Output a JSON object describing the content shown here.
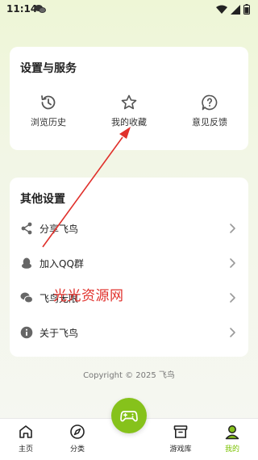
{
  "status_bar": {
    "time": "11:14"
  },
  "services": {
    "title": "设置与服务",
    "items": [
      {
        "label": "浏览历史",
        "icon": "history-icon"
      },
      {
        "label": "我的收藏",
        "icon": "star-icon"
      },
      {
        "label": "意见反馈",
        "icon": "feedback-icon"
      }
    ]
  },
  "other": {
    "title": "其他设置",
    "items": [
      {
        "label": "分享飞鸟",
        "icon": "share-icon"
      },
      {
        "label": "加入QQ群",
        "icon": "qq-icon"
      },
      {
        "label": "飞鸟无限",
        "icon": "wechat-icon"
      },
      {
        "label": "关于飞鸟",
        "icon": "info-icon"
      }
    ]
  },
  "copyright": "Copyright © 2025 飞鸟",
  "watermark": "光光资源网",
  "tabbar": {
    "active_color": "#7bc300",
    "fab_color": "#86c21b",
    "items": [
      {
        "label": "主页",
        "icon": "home-icon"
      },
      {
        "label": "分类",
        "icon": "compass-icon"
      },
      {
        "label": "",
        "icon": "gamepad-icon"
      },
      {
        "label": "游戏库",
        "icon": "archive-icon"
      },
      {
        "label": "我的",
        "icon": "user-icon"
      }
    ]
  }
}
